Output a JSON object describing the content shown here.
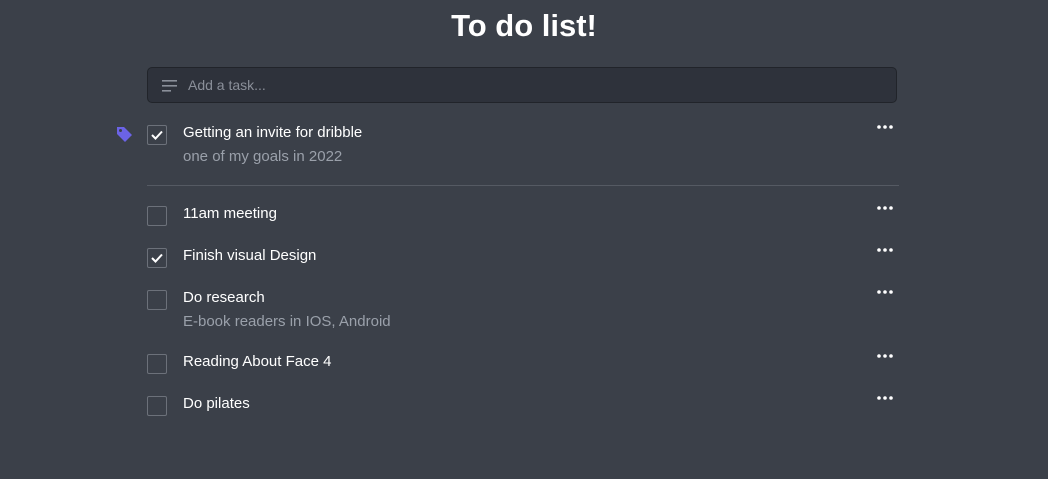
{
  "header": {
    "title": "To do list!"
  },
  "add_task": {
    "placeholder": "Add a task..."
  },
  "colors": {
    "tag": "#6b63e6",
    "background": "#3b4049"
  },
  "tasks": [
    {
      "title": "Getting an invite for dribble",
      "subtitle": "one of my goals in 2022",
      "checked": true,
      "tagged": true
    },
    {
      "title": "11am meeting",
      "subtitle": "",
      "checked": false,
      "tagged": false
    },
    {
      "title": "Finish visual Design",
      "subtitle": "",
      "checked": true,
      "tagged": false
    },
    {
      "title": "Do research",
      "subtitle": "E-book readers in IOS, Android",
      "checked": false,
      "tagged": false
    },
    {
      "title": "Reading About Face 4",
      "subtitle": "",
      "checked": false,
      "tagged": false
    },
    {
      "title": "Do pilates",
      "subtitle": "",
      "checked": false,
      "tagged": false
    }
  ]
}
